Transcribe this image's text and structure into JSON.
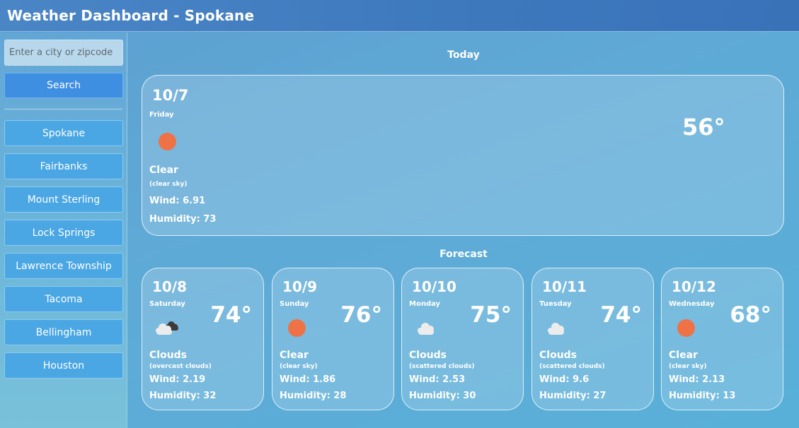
{
  "header": {
    "title": "Weather Dashboard - Spokane"
  },
  "sidebar": {
    "search_placeholder": "Enter a city or zipcode",
    "search_label": "Search",
    "cities": [
      "Spokane",
      "Fairbanks",
      "Mount Sterling",
      "Lock Springs",
      "Lawrence Township",
      "Tacoma",
      "Bellingham",
      "Houston"
    ]
  },
  "today": {
    "heading": "Today",
    "date": "10/7",
    "day": "Friday",
    "icon": "sun-icon",
    "temp": "56°",
    "condition": "Clear",
    "description": "(clear sky)",
    "wind": "Wind: 6.91",
    "humidity": "Humidity: 73"
  },
  "forecast": {
    "heading": "Forecast",
    "days": [
      {
        "date": "10/8",
        "day": "Saturday",
        "icon": "overcast-clouds-icon",
        "temp": "74°",
        "condition": "Clouds",
        "description": "(overcast clouds)",
        "wind": "Wind: 2.19",
        "humidity": "Humidity: 32"
      },
      {
        "date": "10/9",
        "day": "Sunday",
        "icon": "sun-icon",
        "temp": "76°",
        "condition": "Clear",
        "description": "(clear sky)",
        "wind": "Wind: 1.86",
        "humidity": "Humidity: 28"
      },
      {
        "date": "10/10",
        "day": "Monday",
        "icon": "cloud-icon",
        "temp": "75°",
        "condition": "Clouds",
        "description": "(scattered clouds)",
        "wind": "Wind: 2.53",
        "humidity": "Humidity: 30"
      },
      {
        "date": "10/11",
        "day": "Tuesday",
        "icon": "cloud-icon",
        "temp": "74°",
        "condition": "Clouds",
        "description": "(scattered clouds)",
        "wind": "Wind: 9.6",
        "humidity": "Humidity: 27"
      },
      {
        "date": "10/12",
        "day": "Wednesday",
        "icon": "sun-icon",
        "temp": "68°",
        "condition": "Clear",
        "description": "(clear sky)",
        "wind": "Wind: 2.13",
        "humidity": "Humidity: 13"
      }
    ]
  },
  "colors": {
    "sun": "#ef7247",
    "search_button": "#3e8ee2",
    "city_button": "#4aa7e4",
    "header": "#3d78bd"
  }
}
